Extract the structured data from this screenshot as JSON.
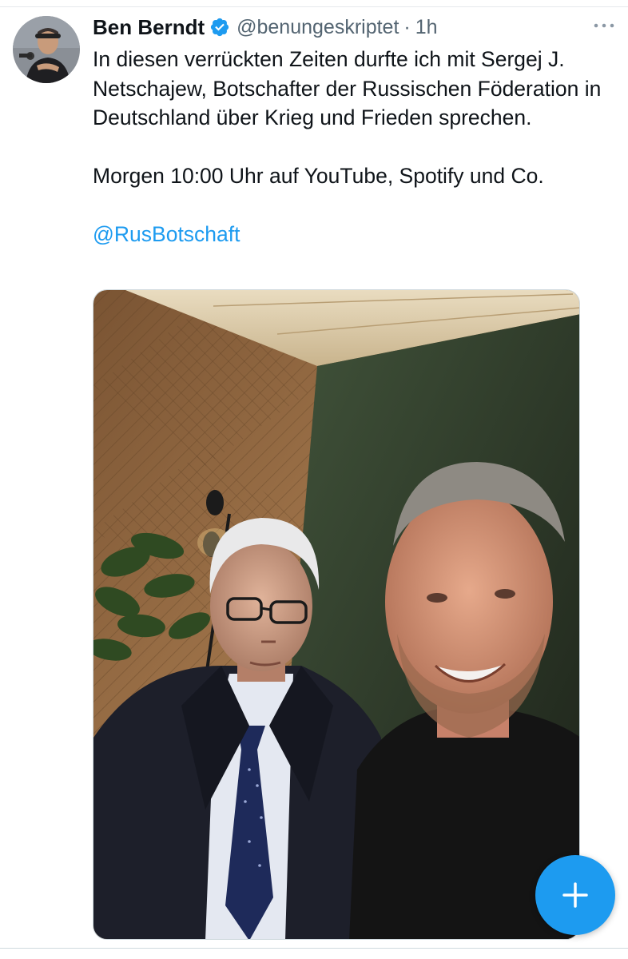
{
  "tweet": {
    "author": {
      "display_name": "Ben Berndt",
      "handle": "@benungeskriptet",
      "verified": true
    },
    "separator": "·",
    "time": "1h",
    "paragraphs": [
      "In diesen verrückten Zeiten durfte ich mit Sergej J. Netschajew, Botschafter der Russischen Föderation in Deutschland über Krieg und Frieden sprechen.",
      "Morgen 10:00 Uhr auf YouTube, Spotify und Co."
    ],
    "mention": "@RusBotschaft",
    "media": {
      "type": "photo"
    }
  },
  "compose_button": {
    "icon": "plus-icon"
  },
  "colors": {
    "accent": "#1d9bf0",
    "text_primary": "#0f1419",
    "text_secondary": "#536471",
    "background": "#ffffff"
  }
}
